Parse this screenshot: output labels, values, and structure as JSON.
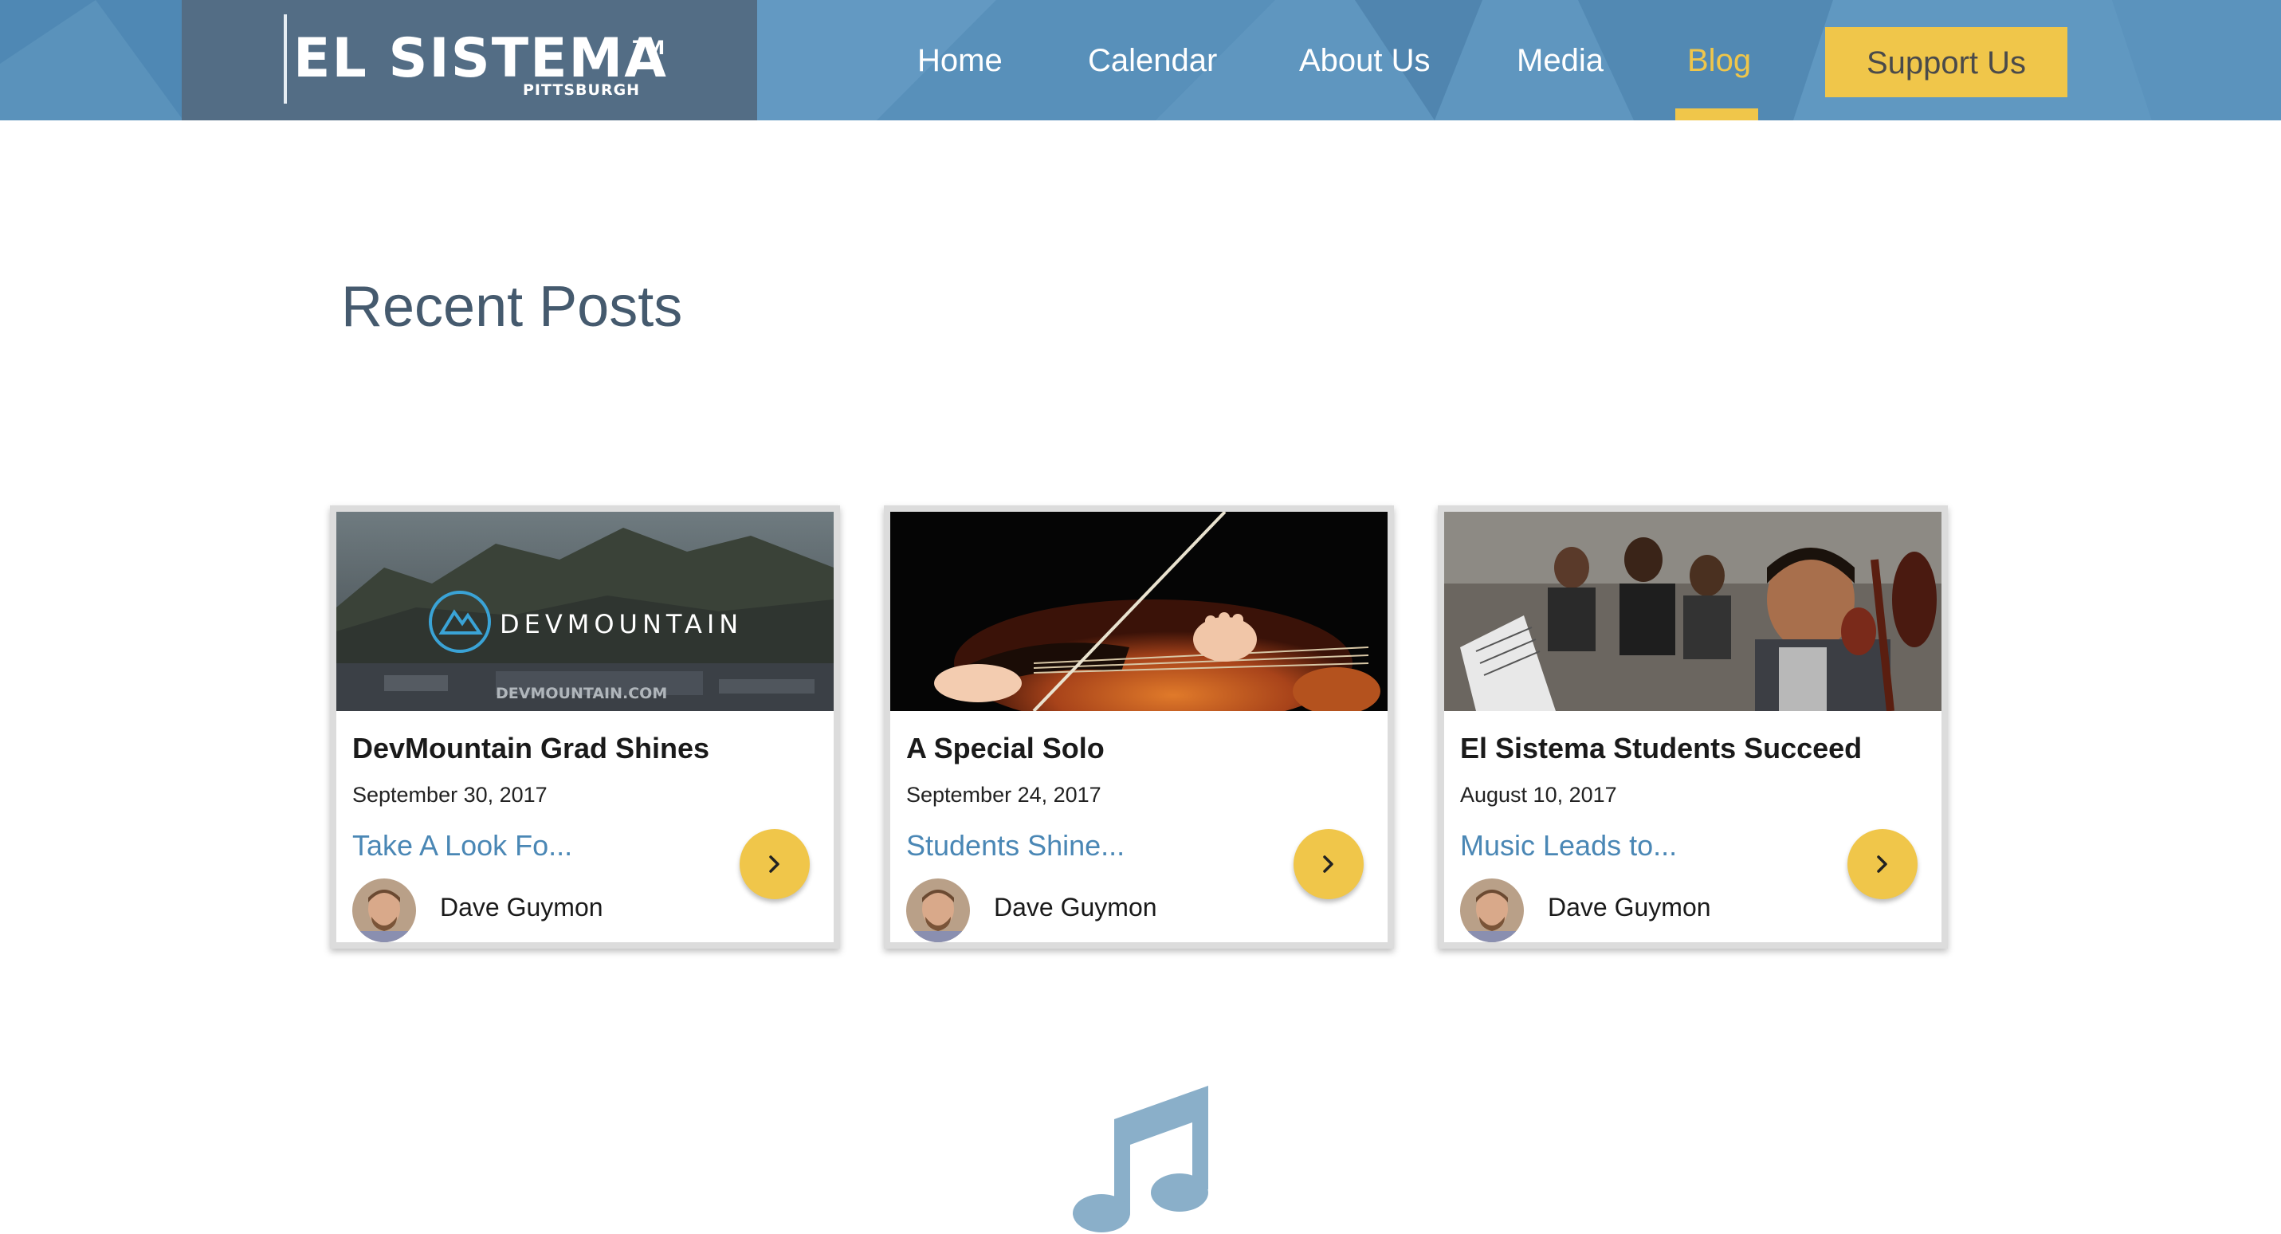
{
  "logo": {
    "main": "EL SISTEMA",
    "tm": "TM",
    "sub": "PITTSBURGH"
  },
  "nav": {
    "items": [
      {
        "label": "Home"
      },
      {
        "label": "Calendar"
      },
      {
        "label": "About Us"
      },
      {
        "label": "Media"
      },
      {
        "label": "Blog",
        "active": true
      }
    ],
    "cta_label": "Support Us"
  },
  "page": {
    "title": "Recent Posts"
  },
  "posts": [
    {
      "title": "DevMountain Grad Shines",
      "date": "September 30, 2017",
      "excerpt": "Take A Look Fo...",
      "author": "Dave Guymon",
      "image_brand": "DEVMOUNTAIN",
      "image_url_text": "DEVMOUNTAIN.COM"
    },
    {
      "title": "A Special Solo",
      "date": "September 24, 2017",
      "excerpt": "Students Shine...",
      "author": "Dave Guymon"
    },
    {
      "title": "El Sistema Students Succeed",
      "date": "August 10, 2017",
      "excerpt": "Music Leads to...",
      "author": "Dave Guymon"
    }
  ],
  "colors": {
    "header_blue": "#5b93bd",
    "logo_box": "#536d85",
    "accent_yellow": "#f0c64a",
    "title_slate": "#455a6e",
    "link_blue": "#4a87b5",
    "note_blue": "#8aafc9"
  },
  "icons": {
    "arrow": "chevron-right-icon",
    "footer": "music-note-icon"
  }
}
